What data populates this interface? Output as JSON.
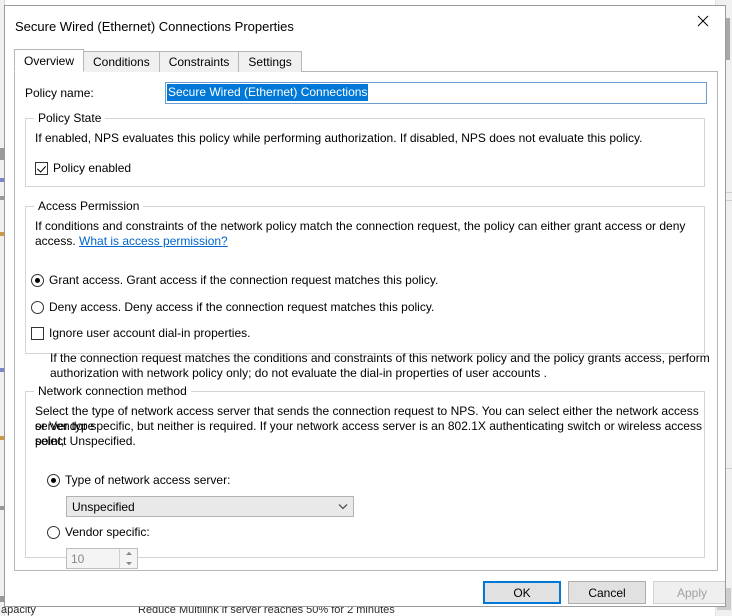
{
  "background": {
    "bottom_left_text": "apacity",
    "bottom_mid_text": "Reduce Multilink if server reaches 50% for 2 minutes"
  },
  "dialog": {
    "title": "Secure Wired (Ethernet) Connections Properties",
    "close_icon": "close-icon",
    "tabs": [
      {
        "label": "Overview",
        "active": true
      },
      {
        "label": "Conditions",
        "active": false
      },
      {
        "label": "Constraints",
        "active": false
      },
      {
        "label": "Settings",
        "active": false
      }
    ],
    "policy_name": {
      "label": "Policy name:",
      "value": "Secure Wired (Ethernet) Connections",
      "placeholder": "",
      "selected": true
    },
    "policy_state": {
      "title": "Policy State",
      "description": "If enabled, NPS evaluates this policy while performing authorization. If disabled, NPS does not evaluate this policy.",
      "checkbox_label": "Policy enabled",
      "checkbox_checked": true
    },
    "access_permission": {
      "title": "Access Permission",
      "description_line1": "If conditions and constraints of the network policy match the connection request, the policy can either grant access or deny",
      "description_line2_prefix": "access. ",
      "link_text": "What is access permission?",
      "grant_label": "Grant access. Grant access if the connection request matches this policy.",
      "grant_selected": true,
      "deny_label": "Deny access. Deny access if the connection request matches this policy.",
      "deny_selected": false,
      "ignore_label": "Ignore user account dial-in properties.",
      "ignore_checked": false,
      "ignore_note_line1": "If the connection request matches the conditions and constraints of this network policy and the policy grants access, perform",
      "ignore_note_line2": "authorization with network policy only; do not evaluate the dial-in properties of user accounts ."
    },
    "network_connection_method": {
      "title": "Network connection method",
      "description_line1": "Select the type of network access server that sends the connection request to NPS. You can select either the network access server type",
      "description_line2": "or Vendor specific, but neither is required.  If your network access server is an 802.1X authenticating switch or wireless access point,",
      "description_line3": "select Unspecified.",
      "type_radio_label": "Type of network access server:",
      "type_radio_selected": true,
      "combo_value": "Unspecified",
      "combo_arrow_icon": "chevron-down-icon",
      "vendor_radio_label": "Vendor specific:",
      "vendor_radio_selected": false,
      "vendor_value": "10",
      "spinner_up_icon": "spinner-up-icon",
      "spinner_down_icon": "spinner-down-icon"
    },
    "footer": {
      "ok_label": "OK",
      "cancel_label": "Cancel",
      "apply_label": "Apply",
      "apply_disabled": true
    }
  },
  "colors": {
    "accent": "#0078d7",
    "link": "#0066cc",
    "dialog_border": "#9b9b9b",
    "group_border": "#d4d4d4"
  }
}
